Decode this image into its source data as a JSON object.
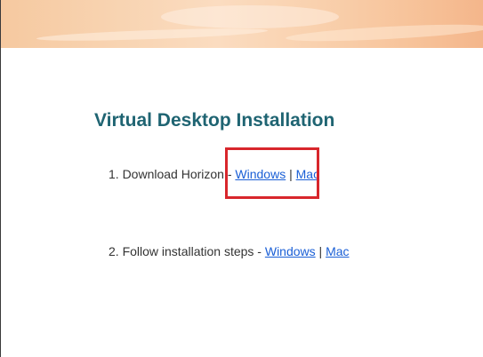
{
  "page": {
    "title": "Virtual Desktop Installation"
  },
  "steps": [
    {
      "text": "1. Download Horizon - ",
      "links": [
        {
          "label": "Windows"
        },
        {
          "label": "Mac"
        }
      ],
      "separator": " | "
    },
    {
      "text": "2. Follow installation steps - ",
      "links": [
        {
          "label": "Windows"
        },
        {
          "label": "Mac"
        }
      ],
      "separator": " | "
    }
  ],
  "annotation": {
    "color": "#d8262c"
  },
  "colors": {
    "title": "#1f6472",
    "link": "#1a5fd6",
    "text": "#333333"
  }
}
